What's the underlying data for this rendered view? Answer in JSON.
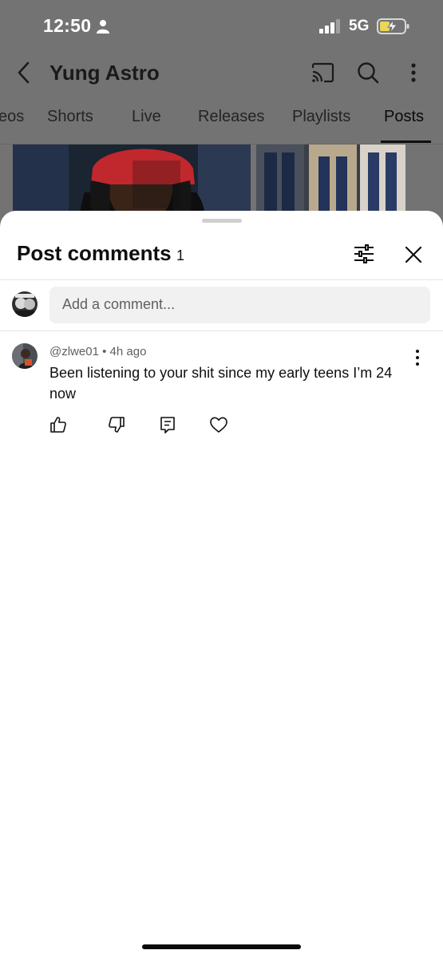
{
  "status_bar": {
    "time": "12:50",
    "network": "5G"
  },
  "header": {
    "channel_name": "Yung Astro"
  },
  "tabs": [
    {
      "label": "eos"
    },
    {
      "label": "Shorts"
    },
    {
      "label": "Live"
    },
    {
      "label": "Releases"
    },
    {
      "label": "Playlists"
    },
    {
      "label": "Posts",
      "active": true
    }
  ],
  "sheet": {
    "title": "Post comments",
    "count": "1",
    "input_placeholder": "Add a comment..."
  },
  "comments": [
    {
      "author": "@zlwe01",
      "separator": "•",
      "time": "4h ago",
      "text": "Been listening to your shit since my early teens I’m 24 now"
    }
  ],
  "colors": {
    "dim_overlay": "#737373",
    "sheet_bg": "#ffffff",
    "input_bg": "#f1f1f1",
    "meta_text": "#606060"
  },
  "icons": {
    "back": "chevron-left-icon",
    "cast": "cast-icon",
    "search": "search-icon",
    "more": "more-vertical-icon",
    "filter": "sliders-icon",
    "close": "close-icon",
    "like": "thumb-up-icon",
    "dislike": "thumb-down-icon",
    "reply": "reply-icon",
    "heart": "heart-icon"
  }
}
